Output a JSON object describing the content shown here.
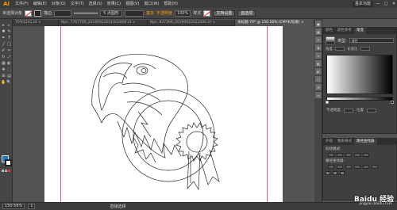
{
  "menubar": {
    "logo": "Ai",
    "items": [
      "文件(F)",
      "编辑(E)",
      "对象(O)",
      "文字(T)",
      "选择(S)",
      "效果(C)",
      "视图(V)",
      "窗口(W)",
      "帮助(H)"
    ],
    "workspace": "基本功能",
    "window_controls": [
      "—",
      "□",
      "✕"
    ]
  },
  "controlbar": {
    "label": "未选择对象",
    "stroke_label": "描边",
    "basic_label": "基本",
    "opacity_label": "不透明度",
    "opacity_value": "100%",
    "style_label": "样式",
    "doc_setup": "文档设置",
    "prefs": "首选项",
    "stroke_profile": "5 点圆形"
  },
  "tabs": [
    {
      "label": "70%1241.tif ×",
      "active": false
    },
    {
      "label": "Nps: 7767700_20190922031002806.tif ×",
      "active": false
    },
    {
      "label": "Nps: 837396_20190922021006.tif ×",
      "active": false
    },
    {
      "label": "未标题-70* @ 150.56% (CMYK/轮廓) ×",
      "active": true
    }
  ],
  "tools": [
    "▸",
    "▹",
    "✱",
    "✎",
    "✒",
    "T",
    "╱",
    "□",
    "✐",
    "✂",
    "↻",
    "⤢",
    "▦",
    "◐",
    "✥",
    "⬚",
    "⊞",
    "▤",
    "✋",
    "🔍"
  ],
  "panels": {
    "gradient_tabs": [
      "颜色",
      "颜色参考",
      "渐变"
    ],
    "gradient_type_label": "类型:",
    "gradient_type_value": "线性",
    "angle_label": "角度",
    "ratio_label": "长宽比",
    "opacity_label": "不透明度",
    "location_label": "位置",
    "layers_tabs": [
      "外观",
      "图形样式",
      "路径查找器"
    ],
    "pathfinder_title": "形状模式:",
    "pathfinder_sub": "路径查找器:",
    "expand_label": "扩展"
  },
  "statusbar": {
    "zoom": "150.56%",
    "page": "1",
    "mode": "直接选择"
  },
  "watermark": {
    "main": "Baidu 经验",
    "sub": "jingyan.baidu.com"
  }
}
